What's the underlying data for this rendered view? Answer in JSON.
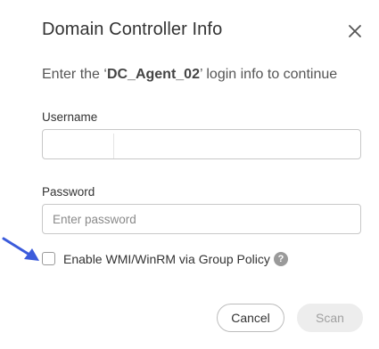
{
  "dialog": {
    "title": "Domain Controller Info",
    "subtitle_prefix": "Enter the ‘",
    "subtitle_agent": "DC_Agent_02",
    "subtitle_suffix": "’ login info to continue",
    "close_icon": "close-icon"
  },
  "username": {
    "label": "Username",
    "value": "",
    "placeholder": ""
  },
  "password": {
    "label": "Password",
    "value": "",
    "placeholder": "Enter password"
  },
  "group_policy": {
    "label": "Enable WMI/WinRM via Group Policy",
    "checked": false,
    "help_glyph": "?"
  },
  "annotation": {
    "arrow_color": "#3b5bdb",
    "icon": "arrow-pointer-icon"
  },
  "buttons": {
    "cancel_label": "Cancel",
    "scan_label": "Scan",
    "scan_disabled": true
  }
}
